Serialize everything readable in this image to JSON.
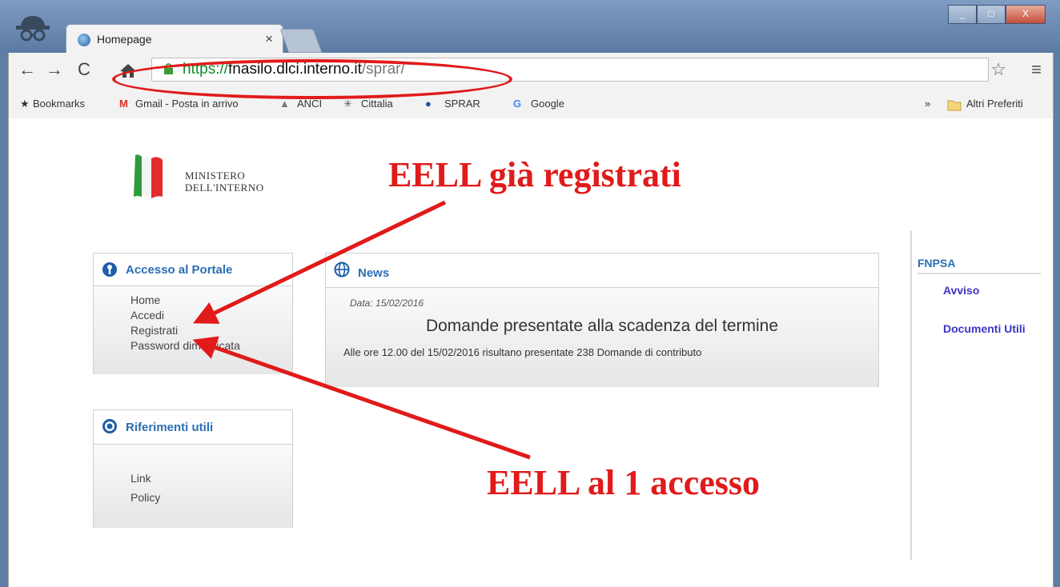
{
  "browser": {
    "tab_title": "Homepage",
    "tab_close": "×",
    "url_scheme": "https://",
    "url_host": "fnasilo.dlci.interno.it",
    "url_path": "/sprar/",
    "window_controls": [
      "_",
      "□",
      "X"
    ]
  },
  "bookmarks": {
    "label": "Bookmarks",
    "items": [
      "Gmail - Posta in arrivo",
      "ANCI",
      "Cittalia",
      "SPRAR",
      "Google"
    ],
    "overflow": "»",
    "other": "Altri Preferiti"
  },
  "logo": {
    "line1": "MINISTERO",
    "line2": "DELL'INTERNO"
  },
  "access_panel": {
    "title": "Accesso al Portale",
    "items": [
      "Home",
      "Accedi",
      "Registrati",
      "Password dimenticata"
    ]
  },
  "references_panel": {
    "title": "Riferimenti utili",
    "items": [
      "Link",
      "Policy"
    ]
  },
  "news": {
    "title": "News",
    "date": "Data: 15/02/2016",
    "headline": "Domande presentate alla scadenza del termine",
    "text": "Alle ore 12.00 del 15/02/2016 risultano presentate 238 Domande di contributo"
  },
  "right_sidebar": {
    "title": "FNPSA",
    "links": [
      "Avviso",
      "Documenti Utili"
    ]
  },
  "annotations": {
    "top": "EELL già registrati",
    "bottom": "EELL al 1 accesso"
  },
  "colors": {
    "annotation": "#e11a1a",
    "panel_title": "#2a6fb3",
    "sidebar_link": "#3d35c2"
  }
}
